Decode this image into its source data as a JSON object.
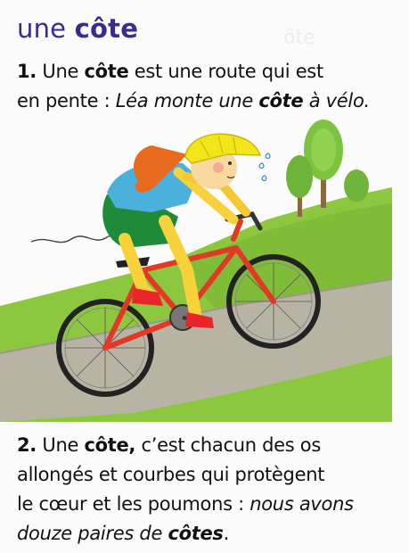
{
  "entry": {
    "article": "une",
    "headword": "côte"
  },
  "definition_1": {
    "number": "1.",
    "text_a": " Une ",
    "word": "côte",
    "text_b": " est une route qui est",
    "text_c": "en pente : ",
    "example_a": "Léa monte une ",
    "example_word": "côte",
    "example_b": " à vélo."
  },
  "definition_2": {
    "number": "2.",
    "text_a": " Une ",
    "word": "côte,",
    "text_b": " c’est chacun des os",
    "line_2": "allongés et courbes qui protègent",
    "line_3a": "le cœur et les poumons : ",
    "example_a": "nous avons",
    "example_b": "douze paires de ",
    "example_word": "côtes",
    "example_end": "."
  },
  "illustration": {
    "icon": "girl-riding-bicycle-uphill",
    "colors": {
      "grass": "#8dc63f",
      "road": "#b8b4a4",
      "helmet": "#f2e61a",
      "shirt": "#4ab0dc",
      "shorts": "#1f8a3a",
      "bike": "#e03a26",
      "hair": "#e86a1e"
    }
  }
}
